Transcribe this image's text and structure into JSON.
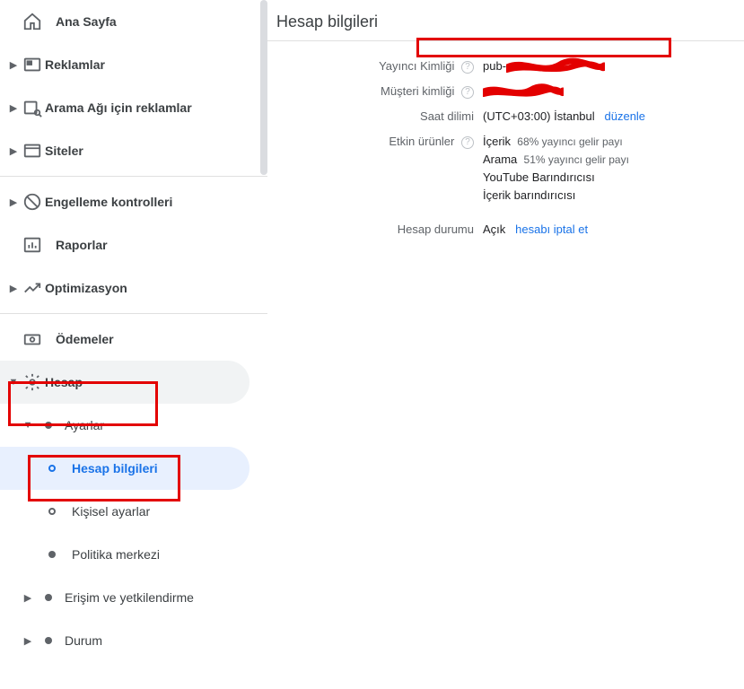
{
  "sidebar": {
    "home": "Ana Sayfa",
    "ads": "Reklamlar",
    "searchAds": "Arama Ağı için reklamlar",
    "sites": "Siteler",
    "blocking": "Engelleme kontrolleri",
    "reports": "Raporlar",
    "optimization": "Optimizasyon",
    "payments": "Ödemeler",
    "account": "Hesap",
    "settings": "Ayarlar",
    "accountInfo": "Hesap bilgileri",
    "personalSettings": "Kişisel ayarlar",
    "policyCenter": "Politika merkezi",
    "access": "Erişim ve yetkilendirme",
    "status": "Durum"
  },
  "main": {
    "title": "Hesap bilgileri",
    "publisherId": {
      "label": "Yayıncı Kimliği",
      "value": "pub-"
    },
    "customerId": {
      "label": "Müşteri kimliği"
    },
    "timezone": {
      "label": "Saat dilimi",
      "value": "(UTC+03:00) İstanbul",
      "edit": "düzenle"
    },
    "activeProducts": {
      "label": "Etkin ürünler",
      "lines": [
        {
          "name": "İçerik",
          "share": "68% yayıncı gelir payı"
        },
        {
          "name": "Arama",
          "share": "51% yayıncı gelir payı"
        },
        {
          "name": "YouTube Barındırıcısı"
        },
        {
          "name": "İçerik barındırıcısı"
        }
      ]
    },
    "accountStatus": {
      "label": "Hesap durumu",
      "value": "Açık",
      "cancel": "hesabı iptal et"
    }
  }
}
